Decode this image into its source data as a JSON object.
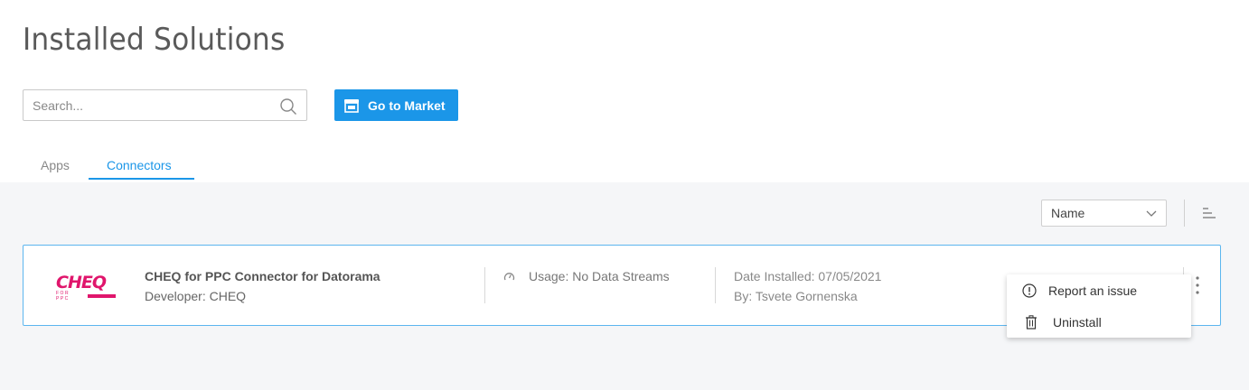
{
  "page": {
    "title": "Installed Solutions"
  },
  "search": {
    "placeholder": "Search..."
  },
  "toolbar": {
    "go_to_market_label": "Go to Market"
  },
  "tabs": [
    {
      "label": "Apps",
      "active": false
    },
    {
      "label": "Connectors",
      "active": true
    }
  ],
  "sort": {
    "selected": "Name"
  },
  "connector": {
    "logo_text": "CHEQ",
    "logo_subtext": "FOR PPC",
    "name": "CHEQ for PPC Connector for Datorama",
    "developer": "Developer: CHEQ",
    "usage": "Usage: No Data Streams",
    "date_installed": "Date Installed: 07/05/2021",
    "installed_by": "By: Tsvete Gornenska"
  },
  "menu": {
    "items": [
      {
        "label": "Report an issue",
        "icon": "info-icon"
      },
      {
        "label": "Uninstall",
        "icon": "trash-icon"
      }
    ]
  },
  "colors": {
    "accent": "#1b96e8",
    "brand": "#e0166c",
    "card_border": "#5cb6ef"
  }
}
